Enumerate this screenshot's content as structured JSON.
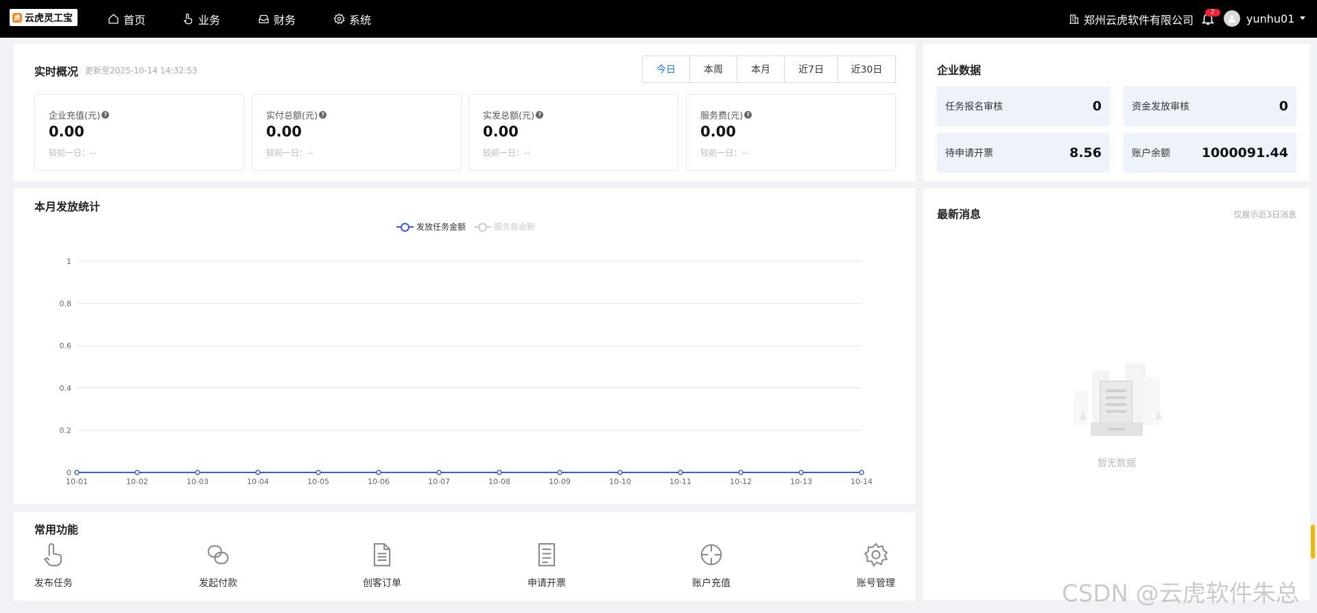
{
  "brand": {
    "name": "云虎灵工宝",
    "mark": "虎"
  },
  "nav": [
    {
      "label": "首页",
      "icon": "home-icon"
    },
    {
      "label": "业务",
      "icon": "hand-pointer-icon"
    },
    {
      "label": "财务",
      "icon": "wallet-icon"
    },
    {
      "label": "系统",
      "icon": "gear-icon"
    }
  ],
  "header": {
    "company": "郑州云虎软件有限公司",
    "notification_count": "2",
    "username": "yunhu01"
  },
  "overview": {
    "title": "实时概况",
    "updated": "更新至2025-10-14 14:32:53",
    "ranges": [
      "今日",
      "本周",
      "本月",
      "近7日",
      "近30日"
    ],
    "active_range": "今日",
    "cards": [
      {
        "label": "企业充值(元)",
        "value": "0.00",
        "compare": "较前一日：--"
      },
      {
        "label": "实付总额(元)",
        "value": "0.00",
        "compare": "较前一日：--"
      },
      {
        "label": "实发总额(元)",
        "value": "0.00",
        "compare": "较前一日：--"
      },
      {
        "label": "服务费(元)",
        "value": "0.00",
        "compare": "较前一日：--"
      }
    ]
  },
  "enterprise": {
    "title": "企业数据",
    "items": [
      {
        "label": "任务报名审核",
        "value": "0"
      },
      {
        "label": "资金发放审核",
        "value": "0"
      },
      {
        "label": "待申请开票",
        "value": "8.56"
      },
      {
        "label": "账户余额",
        "value": "1000091.44"
      }
    ]
  },
  "monthly": {
    "title": "本月发放统计"
  },
  "chart_data": {
    "type": "line",
    "title": "",
    "xlabel": "",
    "ylabel": "",
    "x": [
      "10-01",
      "10-02",
      "10-03",
      "10-04",
      "10-05",
      "10-06",
      "10-07",
      "10-08",
      "10-09",
      "10-10",
      "10-11",
      "10-12",
      "10-13",
      "10-14"
    ],
    "ylim": [
      0,
      1
    ],
    "yticks": [
      "0",
      "0.2",
      "0.4",
      "0.6",
      "0.8",
      "1"
    ],
    "grid": true,
    "legend_position": "top-center",
    "series": [
      {
        "name": "发放任务金额",
        "values": [
          0,
          0,
          0,
          0,
          0,
          0,
          0,
          0,
          0,
          0,
          0,
          0,
          0,
          0
        ],
        "color": "#3b5bdb",
        "active": true
      },
      {
        "name": "服务费金额",
        "values": [
          0,
          0,
          0,
          0,
          0,
          0,
          0,
          0,
          0,
          0,
          0,
          0,
          0,
          0
        ],
        "color": "#cccccc",
        "active": false
      }
    ]
  },
  "functions": {
    "title": "常用功能",
    "items": [
      {
        "label": "发布任务",
        "icon": "hand-pointer-icon"
      },
      {
        "label": "发起付款",
        "icon": "link-icon"
      },
      {
        "label": "创客订单",
        "icon": "document-icon"
      },
      {
        "label": "申请开票",
        "icon": "invoice-icon"
      },
      {
        "label": "账户充值",
        "icon": "target-icon"
      },
      {
        "label": "账号管理",
        "icon": "gear-icon"
      }
    ]
  },
  "messages": {
    "title": "最新消息",
    "note": "仅展示近3日消息",
    "empty": "暂无数据"
  },
  "watermark": "CSDN @云虎软件朱总",
  "colors": {
    "accent": "#1677ff",
    "series_primary": "#3b5bdb",
    "topbar": "#000000",
    "card_bg": "#eef2fa"
  }
}
